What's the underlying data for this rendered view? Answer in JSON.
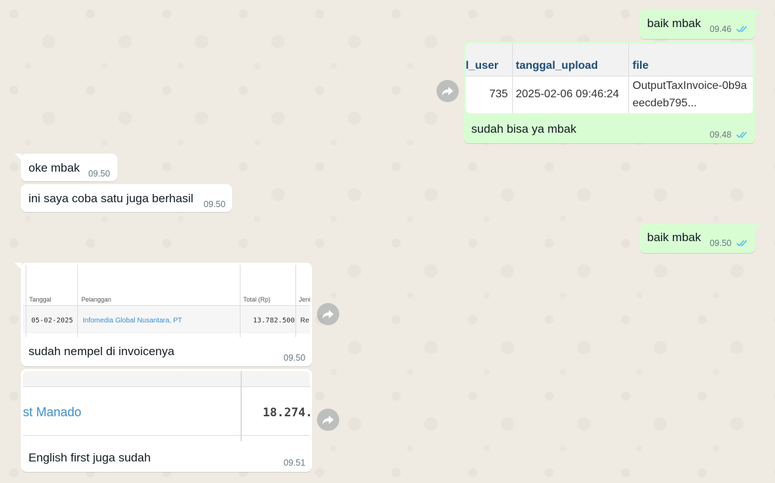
{
  "messages": {
    "m1": {
      "text": "baik mbak",
      "time": "09.46"
    },
    "m2": {
      "table": {
        "headers": [
          "l_user",
          "tanggal_upload",
          "file"
        ],
        "row": {
          "user": "735",
          "tanggal": "2025-02-06 09:46:24",
          "file_line1": "OutputTaxInvoice-0b9a",
          "file_line2": "eecdeb795..."
        }
      },
      "caption": "sudah bisa ya mbak",
      "time": "09.48"
    },
    "m3": {
      "text": "oke mbak",
      "time": "09.50"
    },
    "m4": {
      "text": "ini saya coba satu juga berhasil",
      "time": "09.50"
    },
    "m5": {
      "text": "baik mbak",
      "time": "09.50"
    },
    "m6": {
      "table": {
        "headers": [
          "Tanggal",
          "Pelanggan",
          "Total (Rp)",
          "Jeni"
        ],
        "row": {
          "tanggal": "05-02-2025",
          "pelanggan": "Infomedia Global Nusantara, PT",
          "total": "13.782.500",
          "jenis": "Re"
        }
      },
      "caption": "sudah nempel di invoicenya",
      "time": "09.50"
    },
    "m7": {
      "image": {
        "left_text": "st Manado",
        "right_text": "18.274.:"
      },
      "caption": "English first juga sudah",
      "time": "09.51"
    }
  },
  "colors": {
    "outgoing": "#d9fdd3",
    "incoming": "#ffffff",
    "read_ticks": "#53bdeb",
    "link": "#3a8fd1"
  },
  "icons": {
    "forward": "forward-arrow-icon",
    "read": "double-check-icon"
  }
}
